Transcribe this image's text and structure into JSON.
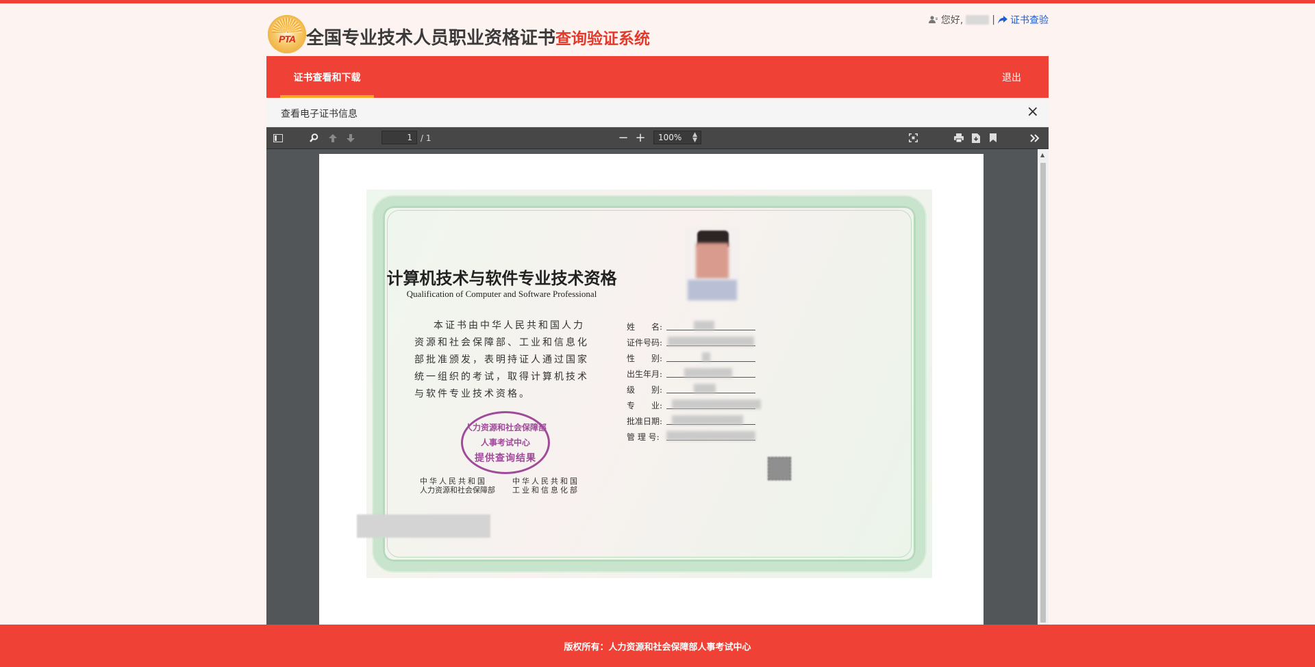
{
  "header": {
    "logo_text": "PTA",
    "title_main": "全国专业技术人员职业资格证书",
    "title_sub": "查询验证系统",
    "user": {
      "greeting": "您好,",
      "separator": "|",
      "verify_link": "证书查验"
    }
  },
  "nav": {
    "active_tab": "证书查看和下载",
    "logout": "退出"
  },
  "panel": {
    "title": "查看电子证书信息",
    "close_icon": "×"
  },
  "pdf_toolbar": {
    "page_current": "1",
    "page_total": "/ 1",
    "zoom": "100%"
  },
  "certificate": {
    "title_cn": "计算机技术与软件专业技术资格",
    "title_en": "Qualification of Computer and Software Professional",
    "body": "本证书由中华人民共和国人力资源和社会保障部、工业和信息化部批准颁发，表明持证人通过国家统一组织的考试，取得计算机技术与软件专业技术资格。",
    "seal": {
      "line1": "人力资源和社会保障部",
      "line2": "人事考试中心",
      "line3": "提供查询结果"
    },
    "issuer_left": {
      "line1": "中华人民共和国",
      "line2": "人力资源和社会保障部"
    },
    "issuer_right": {
      "line1": "中华人民共和国",
      "line2": "工业和信息化部"
    },
    "fields": [
      {
        "label": "姓　　名:"
      },
      {
        "label": "证件号码:"
      },
      {
        "label": "性　　别:"
      },
      {
        "label": "出生年月:"
      },
      {
        "label": "级　　别:"
      },
      {
        "label": "专　　业:"
      },
      {
        "label": "批准日期:"
      },
      {
        "label": "管 理 号:"
      }
    ]
  },
  "footer": {
    "text": "版权所有：人力资源和社会保障部人事考试中心"
  },
  "colors": {
    "brand_red": "#ef4136",
    "accent_orange": "#f6a623",
    "link_blue": "#1a5fd6"
  }
}
